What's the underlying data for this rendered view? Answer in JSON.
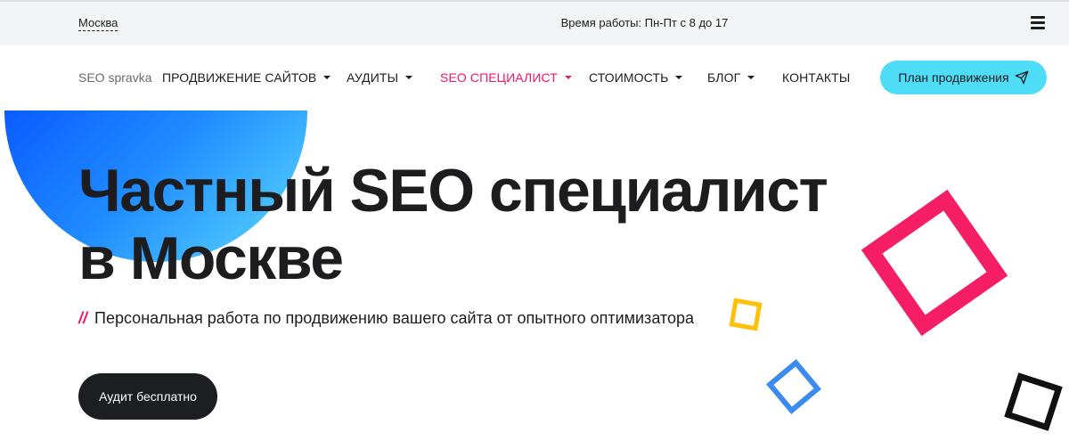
{
  "topbar": {
    "city": "Москва",
    "hours": "Время работы: Пн-Пт с 8 до 17",
    "menu_icon": "hamburger-menu-icon"
  },
  "nav": {
    "logo": "SEO spravka",
    "items": [
      {
        "label": "ПРОДВИЖЕНИЕ САЙТОВ",
        "dropdown": true
      },
      {
        "label": "АУДИТЫ",
        "dropdown": true
      },
      {
        "label": "SEO СПЕЦИАЛИСТ",
        "dropdown": true,
        "active": true
      },
      {
        "label": "СТОИМОСТЬ",
        "dropdown": true
      },
      {
        "label": "БЛОГ",
        "dropdown": true
      },
      {
        "label": "КОНТАКТЫ",
        "dropdown": false
      }
    ],
    "cta": {
      "label": "План продвижения",
      "icon": "paper-plane-icon"
    }
  },
  "hero": {
    "title_line1": "Частный SEO специалист",
    "title_line2": "в Москве",
    "subtitle_prefix": "//",
    "subtitle": "Персональная работа по продвижению вашего сайта от опытного оптимизатора",
    "button": "Аудит бесплатно"
  },
  "colors": {
    "accent_pink": "#f0166b",
    "cta_cyan": "#4fdcf7",
    "blob_gradient_start": "#0b5cff",
    "blob_gradient_end": "#5cdcfb",
    "square_pink": "#f51d64",
    "square_yellow": "#ffc107",
    "square_blue": "#3c8cf0",
    "square_black": "#111111",
    "button_dark": "#1d1e22"
  }
}
